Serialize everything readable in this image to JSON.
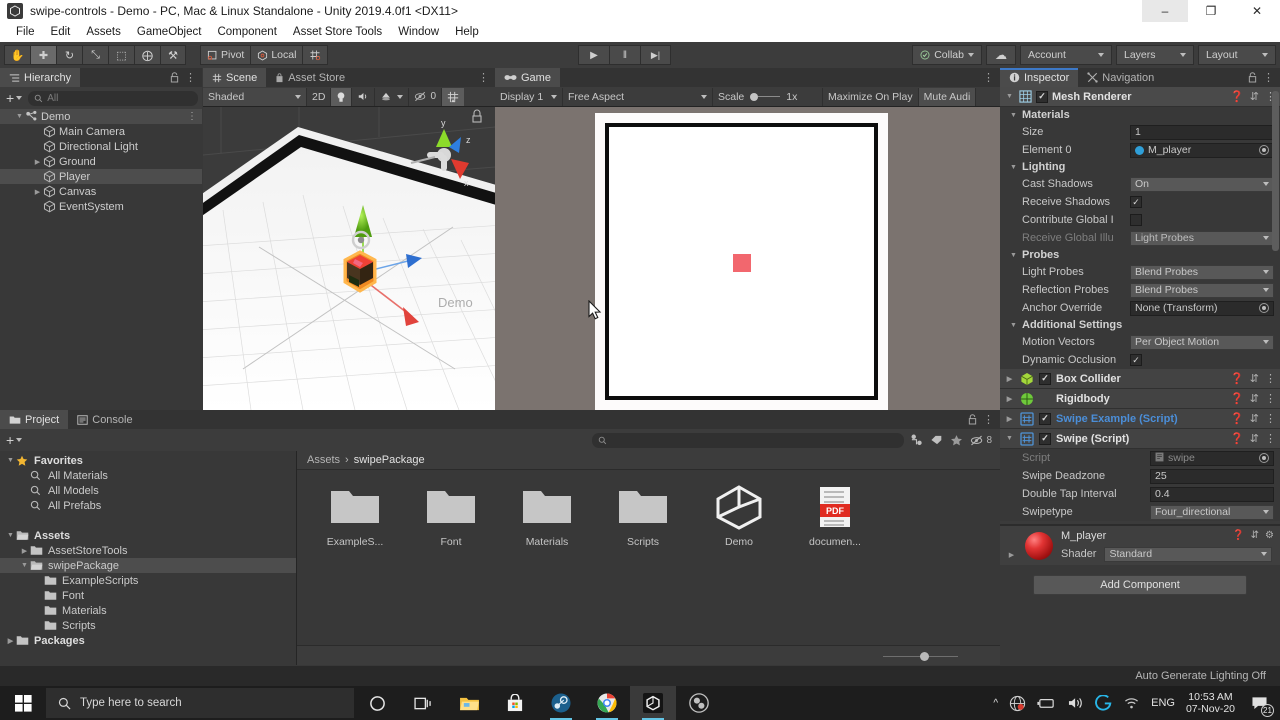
{
  "window": {
    "title": "swipe-controls - Demo - PC, Mac & Linux Standalone - Unity 2019.4.0f1 <DX11>",
    "minimize": "–",
    "maximize": "❐",
    "close": "✕"
  },
  "menubar": {
    "items": [
      "File",
      "Edit",
      "Assets",
      "GameObject",
      "Component",
      "Asset Store Tools",
      "Window",
      "Help"
    ]
  },
  "toolbar": {
    "transform_tools": [
      {
        "name": "hand-tool",
        "glyph": "✋"
      },
      {
        "name": "move-tool",
        "glyph": "✚"
      },
      {
        "name": "rotate-tool",
        "glyph": "↻"
      },
      {
        "name": "scale-tool",
        "glyph": "⤡"
      },
      {
        "name": "rect-tool",
        "glyph": "⬚"
      },
      {
        "name": "transform-tool",
        "glyph": "⨁"
      },
      {
        "name": "custom-tool",
        "glyph": "⚒"
      }
    ],
    "pivot_label": "Pivot",
    "local_label": "Local",
    "grid_glyph": "⌗",
    "play_glyph": "▶",
    "pause_glyph": "‖",
    "step_glyph": "▶|",
    "collab_label": "Collab",
    "cloud_glyph": "☁",
    "account_label": "Account",
    "layers_label": "Layers",
    "layout_label": "Layout"
  },
  "hierarchy": {
    "tab_label": "Hierarchy",
    "search_placeholder": "All",
    "plus_label": "+",
    "items": [
      {
        "label": "Demo",
        "depth": 0,
        "arrow": "down",
        "selected": false,
        "scene": true
      },
      {
        "label": "Main Camera",
        "depth": 1,
        "arrow": "none",
        "selected": false
      },
      {
        "label": "Directional Light",
        "depth": 1,
        "arrow": "none",
        "selected": false
      },
      {
        "label": "Ground",
        "depth": 1,
        "arrow": "right",
        "selected": false
      },
      {
        "label": "Player",
        "depth": 1,
        "arrow": "none",
        "selected": true
      },
      {
        "label": "Canvas",
        "depth": 1,
        "arrow": "right",
        "selected": false
      },
      {
        "label": "EventSystem",
        "depth": 1,
        "arrow": "none",
        "selected": false
      }
    ]
  },
  "scene": {
    "tab_label": "Scene",
    "asset_store_tab": "Asset Store",
    "shading_mode": "Shaded",
    "mode_2d": "2D",
    "audio_count": "0",
    "gizmo_axes": {
      "y": "y",
      "x": "x",
      "z": "z"
    }
  },
  "game": {
    "tab_label": "Game",
    "display": "Display 1",
    "aspect": "Free Aspect",
    "scale_label": "Scale",
    "scale_value": "1x",
    "maximize_label": "Maximize On Play",
    "mute_label": "Mute Audi",
    "player_color": "#f2676e"
  },
  "inspector": {
    "tab_label": "Inspector",
    "navigation_tab": "Navigation",
    "mesh_renderer": {
      "title": "Mesh Renderer",
      "enabled": true,
      "sections": [
        {
          "title": "Materials",
          "rows": [
            {
              "label": "Size",
              "type": "text",
              "value": "1"
            },
            {
              "label": "Element 0",
              "type": "object",
              "value": "M_player"
            }
          ]
        },
        {
          "title": "Lighting",
          "rows": [
            {
              "label": "Cast Shadows",
              "type": "dropdown",
              "value": "On"
            },
            {
              "label": "Receive Shadows",
              "type": "checkbox",
              "value": true
            },
            {
              "label": "Contribute Global I",
              "type": "checkbox",
              "value": false
            },
            {
              "label": "Receive Global Illu",
              "type": "dropdown",
              "value": "Light Probes",
              "dim": true
            }
          ]
        },
        {
          "title": "Probes",
          "rows": [
            {
              "label": "Light Probes",
              "type": "dropdown",
              "value": "Blend Probes"
            },
            {
              "label": "Reflection Probes",
              "type": "dropdown",
              "value": "Blend Probes"
            },
            {
              "label": "Anchor Override",
              "type": "object",
              "value": "None (Transform)"
            }
          ]
        },
        {
          "title": "Additional Settings",
          "rows": [
            {
              "label": "Motion Vectors",
              "type": "dropdown",
              "value": "Per Object Motion"
            },
            {
              "label": "Dynamic Occlusion",
              "type": "checkbox",
              "value": true
            }
          ]
        }
      ]
    },
    "components": [
      {
        "name": "Box Collider",
        "checkbox": true,
        "icon_color": "#a4d83b",
        "expanded": false,
        "blue": false
      },
      {
        "name": "Rigidbody",
        "checkbox": false,
        "icon_color": "#6fc93b",
        "expanded": false,
        "blue": false
      },
      {
        "name": "Swipe Example (Script)",
        "checkbox": true,
        "icon_color": "#4f93d6",
        "expanded": false,
        "blue": true
      },
      {
        "name": "Swipe (Script)",
        "checkbox": true,
        "icon_color": "#4f93d6",
        "expanded": true,
        "blue": false
      }
    ],
    "swipe_script": {
      "rows": [
        {
          "label": "Script",
          "type": "object",
          "value": "swipe",
          "dim": true
        },
        {
          "label": "Swipe Deadzone",
          "type": "text",
          "value": "25"
        },
        {
          "label": "Double Tap Interval",
          "type": "text",
          "value": "0.4"
        },
        {
          "label": "Swipetype",
          "type": "dropdown",
          "value": "Four_directional"
        }
      ]
    },
    "material": {
      "name": "M_player",
      "shader_label": "Shader",
      "shader_value": "Standard"
    },
    "add_component_label": "Add Component"
  },
  "project": {
    "tab_label": "Project",
    "console_tab": "Console",
    "search_placeholder": "",
    "hidden_count": "8",
    "tree": [
      {
        "label": "Favorites",
        "depth": 0,
        "arrow": "down",
        "icon": "star",
        "bold": true,
        "selected": false
      },
      {
        "label": "All Materials",
        "depth": 1,
        "arrow": "none",
        "icon": "search",
        "bold": false,
        "selected": false
      },
      {
        "label": "All Models",
        "depth": 1,
        "arrow": "none",
        "icon": "search",
        "bold": false,
        "selected": false
      },
      {
        "label": "All Prefabs",
        "depth": 1,
        "arrow": "none",
        "icon": "search",
        "bold": false,
        "selected": false
      },
      {
        "label": "",
        "depth": 0,
        "arrow": "none",
        "icon": "none",
        "bold": false,
        "selected": false
      },
      {
        "label": "Assets",
        "depth": 0,
        "arrow": "down",
        "icon": "folder-open",
        "bold": true,
        "selected": false
      },
      {
        "label": "AssetStoreTools",
        "depth": 1,
        "arrow": "right",
        "icon": "folder",
        "bold": false,
        "selected": false
      },
      {
        "label": "swipePackage",
        "depth": 1,
        "arrow": "down",
        "icon": "folder-open",
        "bold": false,
        "selected": true
      },
      {
        "label": "ExampleScripts",
        "depth": 2,
        "arrow": "none",
        "icon": "folder",
        "bold": false,
        "selected": false
      },
      {
        "label": "Font",
        "depth": 2,
        "arrow": "none",
        "icon": "folder",
        "bold": false,
        "selected": false
      },
      {
        "label": "Materials",
        "depth": 2,
        "arrow": "none",
        "icon": "folder",
        "bold": false,
        "selected": false
      },
      {
        "label": "Scripts",
        "depth": 2,
        "arrow": "none",
        "icon": "folder",
        "bold": false,
        "selected": false
      },
      {
        "label": "Packages",
        "depth": 0,
        "arrow": "right",
        "icon": "folder",
        "bold": true,
        "selected": false
      }
    ],
    "breadcrumb": {
      "root": "Assets",
      "sep": "›",
      "current": "swipePackage"
    },
    "assets": [
      {
        "label": "ExampleS...",
        "type": "folder"
      },
      {
        "label": "Font",
        "type": "folder"
      },
      {
        "label": "Materials",
        "type": "folder"
      },
      {
        "label": "Scripts",
        "type": "folder"
      },
      {
        "label": "Demo",
        "type": "unity-scene"
      },
      {
        "label": "documen...",
        "type": "pdf"
      }
    ]
  },
  "statusbar": {
    "text": "Auto Generate Lighting Off"
  },
  "taskbar": {
    "search_placeholder": "Type here to search",
    "language": "ENG",
    "time": "10:53 AM",
    "date": "07-Nov-20",
    "notification_count": "21"
  }
}
